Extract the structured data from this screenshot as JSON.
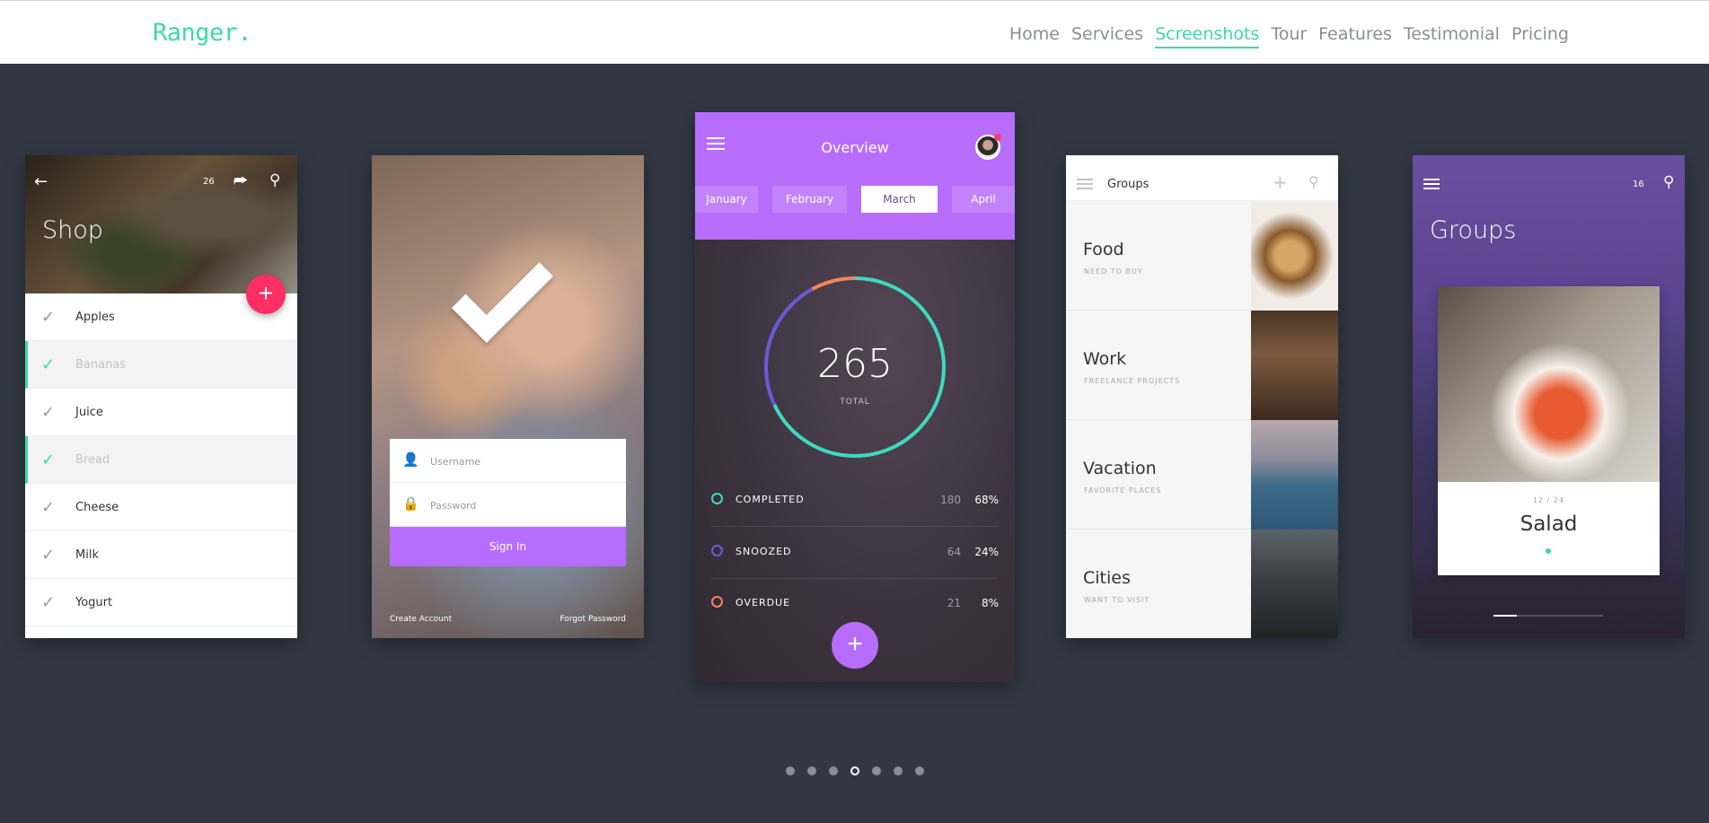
{
  "brand": "Ranger.",
  "nav": [
    {
      "label": "Home",
      "active": false
    },
    {
      "label": "Services",
      "active": false
    },
    {
      "label": "Screenshots",
      "active": true
    },
    {
      "label": "Tour",
      "active": false
    },
    {
      "label": "Features",
      "active": false
    },
    {
      "label": "Testimonial",
      "active": false
    },
    {
      "label": "Pricing",
      "active": false
    }
  ],
  "colors": {
    "accent": "#3ed9a4",
    "background": "#313843",
    "purple": "#b86dfa",
    "pink": "#ff2e63"
  },
  "shop": {
    "title": "Shop",
    "count": "26",
    "items": [
      {
        "label": "Apples",
        "done": false
      },
      {
        "label": "Bananas",
        "done": true
      },
      {
        "label": "Juice",
        "done": false
      },
      {
        "label": "Bread",
        "done": true
      },
      {
        "label": "Cheese",
        "done": false
      },
      {
        "label": "Milk",
        "done": false
      },
      {
        "label": "Yogurt",
        "done": false
      }
    ]
  },
  "login": {
    "username_placeholder": "Username",
    "password_placeholder": "Password",
    "signin": "Sign In",
    "create_account": "Create Account",
    "forgot_password": "Forgot Password"
  },
  "overview": {
    "title": "Overview",
    "months": [
      "January",
      "February",
      "March",
      "April"
    ],
    "selected_month": "March",
    "total": "265",
    "total_label": "TOTAL",
    "stats": [
      {
        "name": "COMPLETED",
        "count": "180",
        "percent": "68%",
        "color": "#3ed9c0"
      },
      {
        "name": "SNOOZED",
        "count": "64",
        "percent": "24%",
        "color": "#6b5ad6"
      },
      {
        "name": "OVERDUE",
        "count": "21",
        "percent": "8%",
        "color": "#f5855b"
      }
    ]
  },
  "groups": {
    "title": "Groups",
    "items": [
      {
        "title": "Food",
        "subtitle": "NEED TO BUY",
        "image": "food"
      },
      {
        "title": "Work",
        "subtitle": "FREELANCE PROJECTS",
        "image": "work"
      },
      {
        "title": "Vacation",
        "subtitle": "FAVORITE PLACES",
        "image": "vacation"
      },
      {
        "title": "Cities",
        "subtitle": "WANT TO VISIT",
        "image": "cities"
      }
    ]
  },
  "groups2": {
    "title": "Groups",
    "count": "16",
    "card_counter": "12 / 24",
    "card_title": "Salad"
  },
  "pager": {
    "total": 7,
    "active_index": 3
  }
}
